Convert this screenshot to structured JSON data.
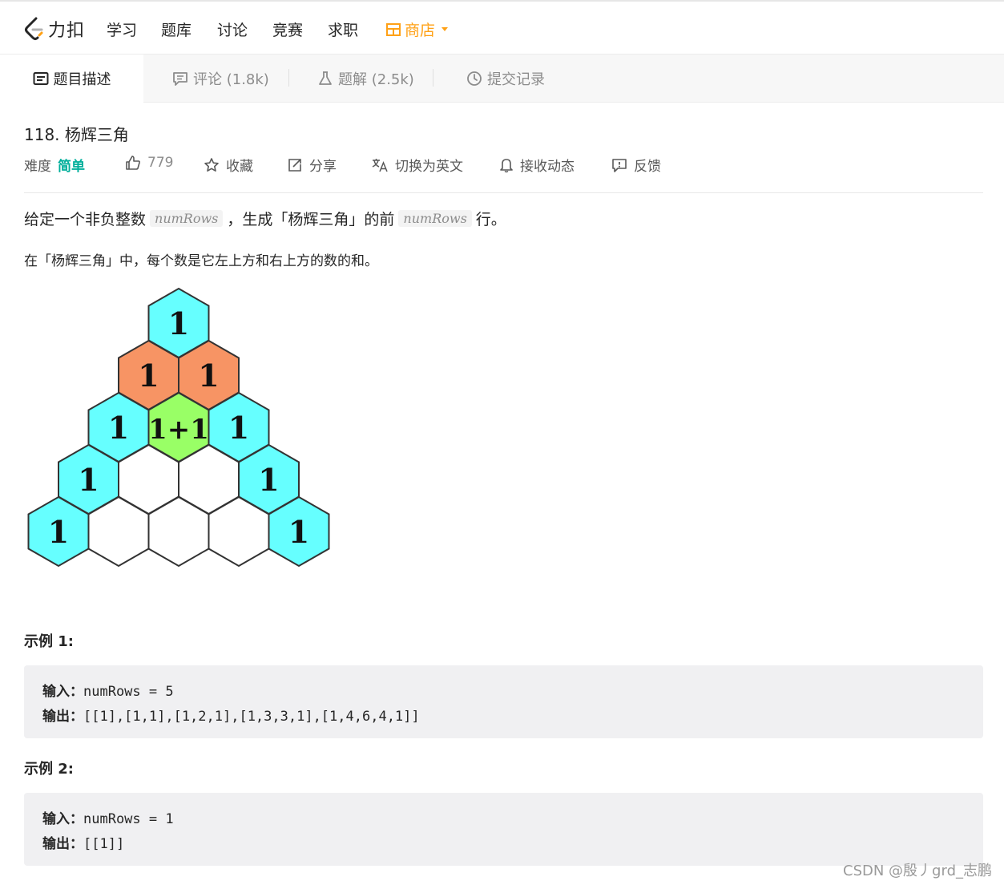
{
  "header": {
    "logo_text": "力扣",
    "nav": [
      "学习",
      "题库",
      "讨论",
      "竞赛",
      "求职"
    ],
    "store_label": "商店",
    "accent": "#ffa116"
  },
  "tabs": [
    {
      "label": "题目描述",
      "icon": "description-icon"
    },
    {
      "label": "评论 (1.8k)",
      "icon": "comment-icon"
    },
    {
      "label": "题解 (2.5k)",
      "icon": "flask-icon"
    },
    {
      "label": "提交记录",
      "icon": "clock-icon"
    }
  ],
  "problem": {
    "title": "118. 杨辉三角",
    "difficulty_label": "难度",
    "difficulty": "简单",
    "difficulty_color": "#00af9b",
    "likes": "779",
    "actions": [
      "收藏",
      "分享",
      "切换为英文",
      "接收动态",
      "反馈"
    ]
  },
  "description": {
    "line1_a": "给定一个非负整数",
    "var": "numRows",
    "line1_b": "，生成「杨辉三角」的前",
    "line1_c": "行。",
    "line2": "在「杨辉三角」中，每个数是它左上方和右上方的数的和。"
  },
  "figure": {
    "rows": [
      [
        "1"
      ],
      [
        "1",
        "1"
      ],
      [
        "1",
        "1+1",
        "1"
      ],
      [
        "1",
        "",
        "",
        "1"
      ],
      [
        "1",
        "",
        "",
        "",
        "1"
      ]
    ],
    "colors": {
      "edge": "#66ffff",
      "row2": "#f79464",
      "sum": "#99ff66",
      "empty": "#ffffff"
    }
  },
  "examples": [
    {
      "title": "示例 1:",
      "input_label": "输入：",
      "input": "numRows = 5",
      "output_label": "输出：",
      "output": "[[1],[1,1],[1,2,1],[1,3,3,1],[1,4,6,4,1]]"
    },
    {
      "title": "示例 2:",
      "input_label": "输入：",
      "input": "numRows = 1",
      "output_label": "输出：",
      "output": "[[1]]"
    }
  ],
  "watermark": "CSDN @殷丿grd_志鹏"
}
